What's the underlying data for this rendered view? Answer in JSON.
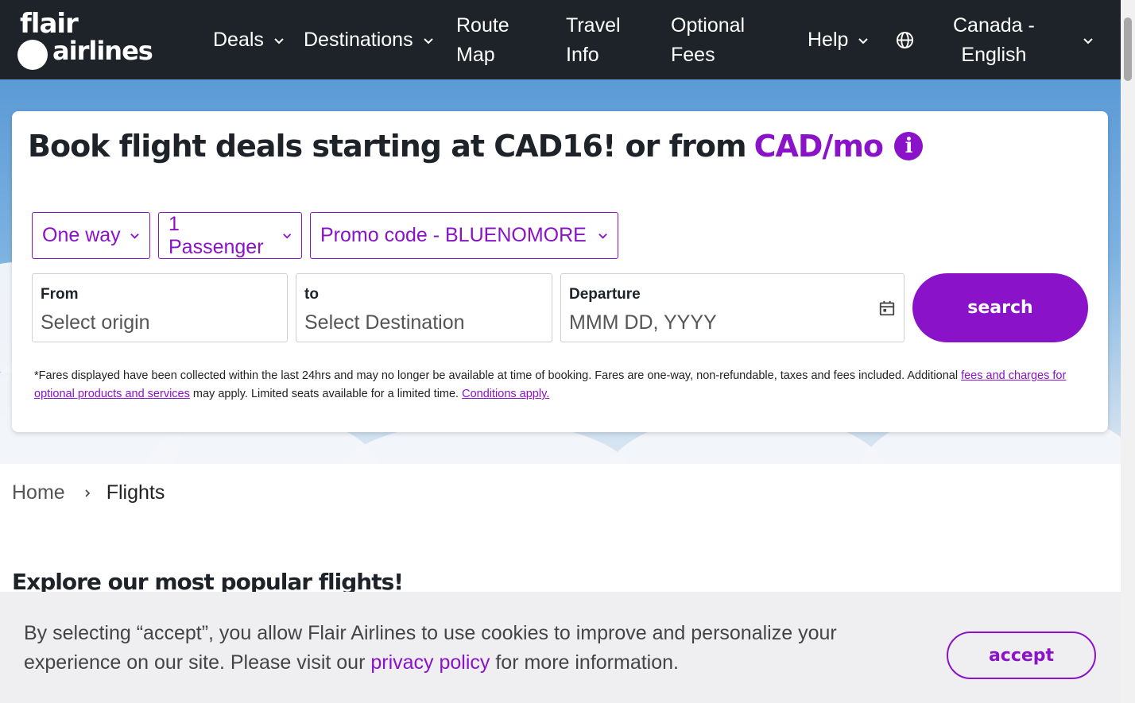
{
  "brand": {
    "logo_top": "flair",
    "logo_bottom": "airlines"
  },
  "nav": {
    "deals": "Deals",
    "destinations": "Destinations",
    "route_map": [
      "Route",
      "Map"
    ],
    "travel_info": [
      "Travel",
      "Info"
    ],
    "optional_fees": [
      "Optional",
      "Fees"
    ],
    "help": "Help",
    "language": [
      "Canada -",
      "English"
    ]
  },
  "hero": {
    "headline_main": "Book flight deals starting at CAD16! or  from",
    "headline_accent": "CAD/mo",
    "info_icon": "i"
  },
  "booking": {
    "trip_type": "One way",
    "passengers": "1 Passenger",
    "promo": "Promo code - BLUENOMORE",
    "from_label": "From",
    "from_placeholder": "Select origin",
    "to_label": "to",
    "to_placeholder": "Select Destination",
    "departure_label": "Departure",
    "departure_placeholder": "MMM DD, YYYY",
    "search_label": "search"
  },
  "disclaimer": {
    "text_1": "*Fares displayed have been collected within the last 24hrs and may no longer be available at time of booking. Fares are one-way, non-refundable, taxes and fees included. Additional ",
    "link_fees": "fees and charges for optional products and services",
    "text_2": " may apply. Limited seats available for a limited time. ",
    "link_conditions": "Conditions apply."
  },
  "breadcrumb": {
    "home": "Home",
    "current": "Flights"
  },
  "section": {
    "title": "Explore our most popular flights!"
  },
  "cookie": {
    "text_1": "By selecting “accept”, you allow Flair Airlines to use cookies to improve and personalize your experience on our site. Please visit our ",
    "link": "privacy policy",
    "text_2": " for more information.",
    "accept_label": "accept"
  },
  "colors": {
    "accent": "#8a12c9",
    "nav_bg": "#1e2329",
    "cookie_bg": "#efeff1"
  }
}
